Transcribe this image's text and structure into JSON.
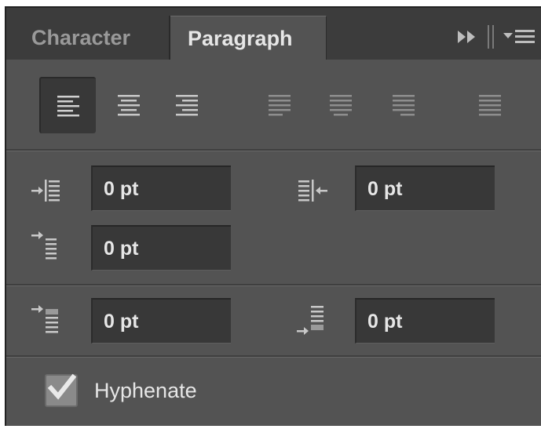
{
  "tabs": [
    {
      "label": "Character",
      "active": false
    },
    {
      "label": "Paragraph",
      "active": true
    }
  ],
  "panel_menu": {
    "expand_icon": "double-chevron-right-icon",
    "menu_icon": "panel-menu-icon"
  },
  "alignment": {
    "buttons": [
      {
        "name": "align-left",
        "selected": true
      },
      {
        "name": "align-center",
        "selected": false
      },
      {
        "name": "align-right",
        "selected": false
      },
      {
        "name": "justify-last-left",
        "selected": false
      },
      {
        "name": "justify-last-center",
        "selected": false
      },
      {
        "name": "justify-last-right",
        "selected": false
      },
      {
        "name": "justify-all",
        "selected": false
      }
    ]
  },
  "indents": {
    "left_indent": "0 pt",
    "right_indent": "0 pt",
    "first_line_indent": "0 pt"
  },
  "spacing": {
    "space_before": "0 pt",
    "space_after": "0 pt"
  },
  "hyphenate": {
    "label": "Hyphenate",
    "checked": true
  },
  "colors": {
    "panel": "#535353",
    "tabbar": "#3c3c3c",
    "field": "#383838",
    "text": "#e6e6e6"
  }
}
